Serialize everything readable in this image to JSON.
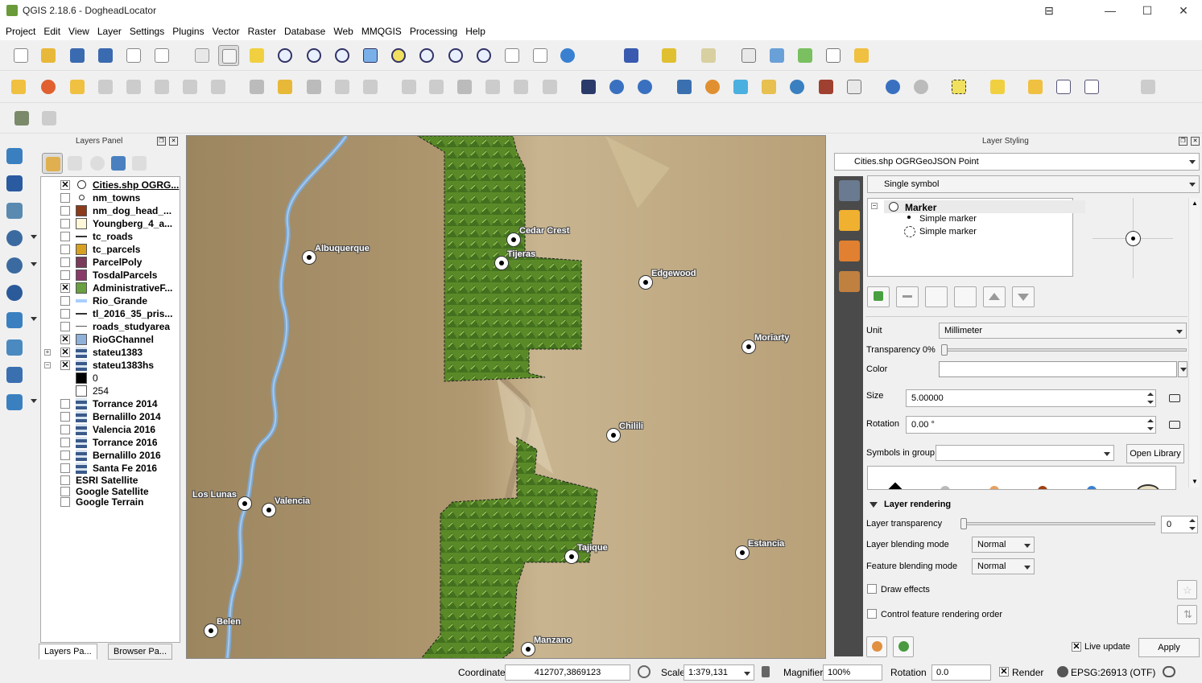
{
  "window": {
    "title": "QGIS 2.18.6 - DogheadLocator",
    "controls": [
      "⊟",
      "—",
      "☐",
      "✕"
    ]
  },
  "menu": [
    "Project",
    "Edit",
    "View",
    "Layer",
    "Settings",
    "Plugins",
    "Vector",
    "Raster",
    "Database",
    "Web",
    "MMQGIS",
    "Processing",
    "Help"
  ],
  "layers_panel": {
    "title": "Layers Panel",
    "layers": [
      {
        "name": "Cities.shp OGRG...",
        "checked": true,
        "selected": true,
        "symbol": "point-circle",
        "color": "#ffffff"
      },
      {
        "name": "nm_towns",
        "checked": false,
        "symbol": "point-dot",
        "color": "#ffffff"
      },
      {
        "name": "nm_dog_head_...",
        "checked": false,
        "symbol": "fill",
        "color": "#8b3a1a"
      },
      {
        "name": "Youngberg_4_a...",
        "checked": false,
        "symbol": "fill",
        "color": "#fff8d8"
      },
      {
        "name": "tc_roads",
        "checked": false,
        "symbol": "line",
        "color": "#333333"
      },
      {
        "name": "tc_parcels",
        "checked": false,
        "symbol": "fill",
        "color": "#d8a020"
      },
      {
        "name": "ParcelPoly",
        "checked": false,
        "symbol": "fill",
        "color": "#7a3a5a"
      },
      {
        "name": "TosdalParcels",
        "checked": false,
        "symbol": "fill",
        "color": "#8a3a6a"
      },
      {
        "name": "AdministrativeF...",
        "checked": true,
        "symbol": "fill",
        "color": "#6aa040"
      },
      {
        "name": "Rio_Grande",
        "checked": false,
        "symbol": "line-light",
        "color": "#a8d0ff"
      },
      {
        "name": "tl_2016_35_pris...",
        "checked": false,
        "symbol": "line",
        "color": "#333333"
      },
      {
        "name": "roads_studyarea",
        "checked": false,
        "symbol": "line-thin",
        "color": "#555555"
      },
      {
        "name": "RioGChannel",
        "checked": true,
        "symbol": "fill",
        "color": "#8fb0d8"
      },
      {
        "name": "stateu1383",
        "checked": true,
        "symbol": "raster",
        "color": "#3a5a8a",
        "expander": "+"
      },
      {
        "name": "stateu1383hs",
        "checked": true,
        "symbol": "raster",
        "color": "#3a5a8a",
        "expander": "−"
      },
      {
        "name": "0",
        "checked": null,
        "symbol": "fill",
        "color": "#000000",
        "plain": true
      },
      {
        "name": "254",
        "checked": null,
        "symbol": "fill",
        "color": "#ffffff",
        "plain": true
      },
      {
        "name": "Torrance 2014",
        "checked": false,
        "symbol": "raster",
        "color": "#3a5a8a"
      },
      {
        "name": "Bernalillo 2014",
        "checked": false,
        "symbol": "raster",
        "color": "#3a5a8a"
      },
      {
        "name": "Valencia 2016",
        "checked": false,
        "symbol": "raster",
        "color": "#3a5a8a"
      },
      {
        "name": "Torrance 2016",
        "checked": false,
        "symbol": "raster",
        "color": "#3a5a8a"
      },
      {
        "name": "Bernalillo 2016",
        "checked": false,
        "symbol": "raster",
        "color": "#3a5a8a"
      },
      {
        "name": "Santa Fe 2016",
        "checked": false,
        "symbol": "raster",
        "color": "#3a5a8a"
      },
      {
        "name": "ESRI Satellite",
        "checked": false,
        "symbol": "none"
      },
      {
        "name": "Google Satellite",
        "checked": false,
        "symbol": "none"
      },
      {
        "name": "Google Terrain",
        "checked": false,
        "symbol": "none"
      }
    ],
    "tabs": [
      "Layers Pa...",
      "Browser Pa..."
    ]
  },
  "map": {
    "cities": [
      {
        "name": "Albuquerque"
      },
      {
        "name": "Cedar Crest"
      },
      {
        "name": "Tijeras"
      },
      {
        "name": "Edgewood"
      },
      {
        "name": "Moriarty"
      },
      {
        "name": "Chilili"
      },
      {
        "name": "Los Lunas"
      },
      {
        "name": "Valencia"
      },
      {
        "name": "Tajique"
      },
      {
        "name": "Estancia"
      },
      {
        "name": "Belen"
      },
      {
        "name": "Manzano"
      }
    ]
  },
  "styling": {
    "title": "Layer Styling",
    "layer_combo": "Cities.shp OGRGeoJSON Point",
    "renderer": "Single symbol",
    "tree": [
      "Marker",
      "Simple marker",
      "Simple marker"
    ],
    "unit_label": "Unit",
    "unit_value": "Millimeter",
    "transparency_label": "Transparency 0%",
    "color_label": "Color",
    "size_label": "Size",
    "size_value": "5.00000",
    "rotation_label": "Rotation",
    "rotation_value": "0.00 °",
    "symbols_group_label": "Symbols in group",
    "open_library": "Open Library",
    "layer_rendering": "Layer rendering",
    "layer_transparency_label": "Layer transparency",
    "layer_transparency_value": "0",
    "layer_blending_label": "Layer blending mode",
    "layer_blending_value": "Normal",
    "feature_blending_label": "Feature blending mode",
    "feature_blending_value": "Normal",
    "draw_effects": "Draw effects",
    "control_order": "Control feature rendering order",
    "live_update": "Live update",
    "apply": "Apply"
  },
  "status": {
    "coordinate_label": "Coordinate",
    "coordinate_value": "412707,3869123",
    "scale_label": "Scale",
    "scale_value": "1:379,131",
    "magnifier_label": "Magnifier",
    "magnifier_value": "100%",
    "rotation_label": "Rotation",
    "rotation_value": "0.0",
    "render_label": "Render",
    "crs": "EPSG:26913 (OTF)"
  }
}
